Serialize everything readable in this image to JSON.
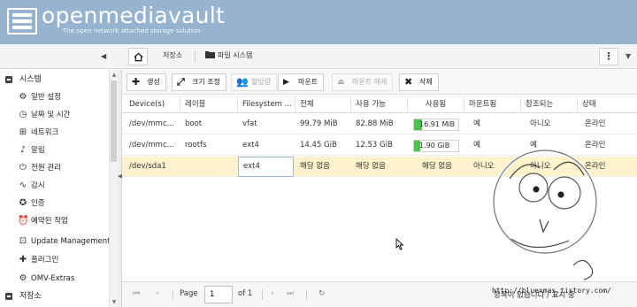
{
  "app": {
    "title": "openmediavault",
    "subtitle": "The open network attached storage solution"
  },
  "breadcrumb": {
    "home_icon": "home-icon",
    "storage": "저장소",
    "current": "파일 시스템",
    "folder_icon": "folder-icon"
  },
  "sidebar": {
    "system_label": "시스템",
    "items": [
      {
        "label": "일반 설정",
        "icon": "gear-icon"
      },
      {
        "label": "날짜 및 시간",
        "icon": "clock-icon"
      },
      {
        "label": "네트워크",
        "icon": "network-icon"
      },
      {
        "label": "알림",
        "icon": "bell-icon"
      },
      {
        "label": "전원 관리",
        "icon": "power-icon"
      },
      {
        "label": "감시",
        "icon": "chart-icon"
      },
      {
        "label": "인증",
        "icon": "certificate-icon"
      },
      {
        "label": "예약된 작업",
        "icon": "calendar-icon"
      },
      {
        "label": "Update Management",
        "icon": "download-icon"
      },
      {
        "label": "플러그인",
        "icon": "plugin-icon"
      },
      {
        "label": "OMV-Extras",
        "icon": "gear-icon"
      }
    ],
    "storage_label": "저장소"
  },
  "actions": {
    "create": "생성",
    "resize": "크기 조정",
    "quota": "할당량",
    "mount": "마운트",
    "unmount": "마운트 해제",
    "delete": "삭제"
  },
  "table": {
    "columns": [
      "Device(s)",
      "레이블",
      "Filesystem ...",
      "전체",
      "사용 가능",
      "사용됨",
      "마운트됨",
      "참조되는",
      "상태"
    ],
    "rows": [
      {
        "device": "/dev/mmc...",
        "label": "boot",
        "fs": "vfat",
        "total": "99.79 MiB",
        "available": "82.88 MiB",
        "used": "16.91 MiB",
        "used_fraction": 0.17,
        "mounted": "예",
        "referenced": "아니오",
        "status": "온라인",
        "selected": false
      },
      {
        "device": "/dev/mmc...",
        "label": "rootfs",
        "fs": "ext4",
        "total": "14.45 GiB",
        "available": "12.53 GiB",
        "used": "1.90 GiB",
        "used_fraction": 0.13,
        "mounted": "예",
        "referenced": "예",
        "status": "온라인",
        "selected": false
      },
      {
        "device": "/dev/sda1",
        "label": "",
        "fs": "ext4",
        "total": "해당 없음",
        "available": "해당 없음",
        "used": "해당 없음",
        "used_fraction": null,
        "mounted": "아니오",
        "referenced": "아니오",
        "status": "온라인",
        "selected": true
      }
    ]
  },
  "paging": {
    "page_label": "Page",
    "page_value": "1",
    "of_label": "of 1",
    "status": "항목이 없습니다 / 표시 중"
  },
  "colors": {
    "header_bg": "#96b4cf",
    "selected_row": "#fff2cc",
    "usage_fill": "#4cc14c"
  },
  "watermark": {
    "url": "http://bluexmas.tistory.com/"
  }
}
